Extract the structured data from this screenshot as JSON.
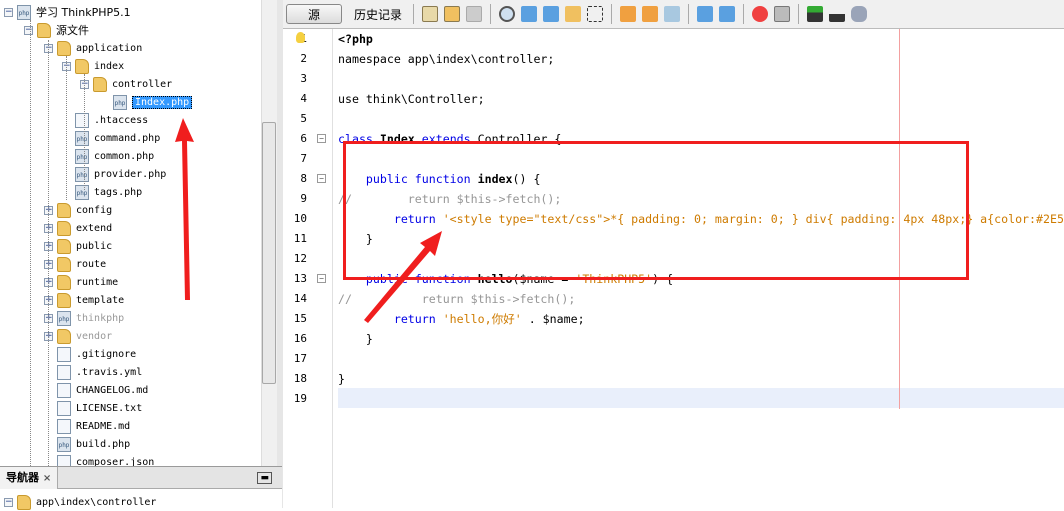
{
  "project_tree": {
    "items": [
      {
        "label": "学习 ThinkPHP5.1",
        "icon": "php-project-icon",
        "toggle": "minus",
        "level": 0
      },
      {
        "label": "源文件",
        "icon": "source-folder-icon",
        "toggle": "minus",
        "level": 1
      },
      {
        "label": "application",
        "icon": "folder-icon",
        "toggle": "minus",
        "level": 2
      },
      {
        "label": "index",
        "icon": "folder-icon",
        "toggle": "minus",
        "level": 3
      },
      {
        "label": "controller",
        "icon": "folder-icon",
        "toggle": "minus",
        "level": 4
      },
      {
        "label": "Index.php",
        "icon": "php-file-icon",
        "level": 5,
        "selected": true
      },
      {
        "label": ".htaccess",
        "icon": "htaccess-file-icon",
        "level": 3
      },
      {
        "label": "command.php",
        "icon": "php-file-icon",
        "level": 3
      },
      {
        "label": "common.php",
        "icon": "php-file-icon",
        "level": 3
      },
      {
        "label": "provider.php",
        "icon": "php-file-icon",
        "level": 3
      },
      {
        "label": "tags.php",
        "icon": "php-file-icon",
        "level": 3
      },
      {
        "label": "config",
        "icon": "folder-icon",
        "toggle": "plus",
        "level": 2
      },
      {
        "label": "extend",
        "icon": "folder-icon",
        "toggle": "plus",
        "level": 2
      },
      {
        "label": "public",
        "icon": "folder-icon",
        "toggle": "plus",
        "level": 2
      },
      {
        "label": "route",
        "icon": "folder-icon",
        "toggle": "plus",
        "level": 2
      },
      {
        "label": "runtime",
        "icon": "folder-icon",
        "toggle": "plus",
        "level": 2
      },
      {
        "label": "template",
        "icon": "folder-icon",
        "toggle": "plus",
        "level": 2
      },
      {
        "label": "thinkphp",
        "icon": "php-project-icon",
        "toggle": "plus",
        "level": 2,
        "dim": true
      },
      {
        "label": "vendor",
        "icon": "folder-icon",
        "toggle": "plus",
        "level": 2,
        "dim": true
      },
      {
        "label": ".gitignore",
        "icon": "file-icon",
        "level": 2
      },
      {
        "label": ".travis.yml",
        "icon": "yml-file-icon",
        "level": 2
      },
      {
        "label": "CHANGELOG.md",
        "icon": "file-icon",
        "level": 2
      },
      {
        "label": "LICENSE.txt",
        "icon": "file-icon",
        "level": 2
      },
      {
        "label": "README.md",
        "icon": "file-icon",
        "level": 2
      },
      {
        "label": "build.php",
        "icon": "php-file-icon",
        "level": 2
      },
      {
        "label": "composer.json",
        "icon": "json-file-icon",
        "level": 2
      }
    ]
  },
  "navigator": {
    "title": "导航器",
    "close": "×",
    "minimize": "▬",
    "item": "app\\index\\controller"
  },
  "toolbar": {
    "source": "源",
    "history": "历史记录"
  },
  "editor": {
    "lines": [
      [
        {
          "t": "<?php",
          "c": "b"
        }
      ],
      [
        {
          "t": "namespace app\\index\\controller;",
          "c": ""
        }
      ],
      [],
      [
        {
          "t": "use think\\Controller;",
          "c": ""
        }
      ],
      [],
      [
        {
          "t": "class ",
          "c": "kw"
        },
        {
          "t": "Index ",
          "c": "b"
        },
        {
          "t": "extends ",
          "c": "kw"
        },
        {
          "t": "Controller {",
          "c": ""
        }
      ],
      [],
      [
        {
          "t": "    public function ",
          "c": "kw"
        },
        {
          "t": "index",
          "c": "b"
        },
        {
          "t": "() {",
          "c": ""
        }
      ],
      [
        {
          "t": "//        return $this->fetch();",
          "c": "cm"
        }
      ],
      [
        {
          "t": "        return ",
          "c": "kw"
        },
        {
          "t": "'<style type=\"text/css\">*{ padding: 0; margin: 0; } div{ padding: 4px 48px;} a{color:#2E5",
          "c": "str"
        }
      ],
      [
        {
          "t": "    }",
          "c": ""
        }
      ],
      [],
      [
        {
          "t": "    public function ",
          "c": "kw"
        },
        {
          "t": "hello",
          "c": "b"
        },
        {
          "t": "($name = ",
          "c": ""
        },
        {
          "t": "'ThinkPHP5'",
          "c": "str"
        },
        {
          "t": ") {",
          "c": ""
        }
      ],
      [
        {
          "t": "//          return $this->fetch();",
          "c": "cm"
        }
      ],
      [
        {
          "t": "        return ",
          "c": "kw"
        },
        {
          "t": "'hello,你好'",
          "c": "str"
        },
        {
          "t": " . $name;",
          "c": ""
        }
      ],
      [
        {
          "t": "    }",
          "c": ""
        }
      ],
      [],
      [
        {
          "t": "}",
          "c": ""
        }
      ],
      []
    ]
  },
  "colors": {
    "annotation": "#f01e1e",
    "selection": "#3399ff",
    "keyword": "#0000e6",
    "string": "#ce7b00",
    "comment": "#969696"
  }
}
